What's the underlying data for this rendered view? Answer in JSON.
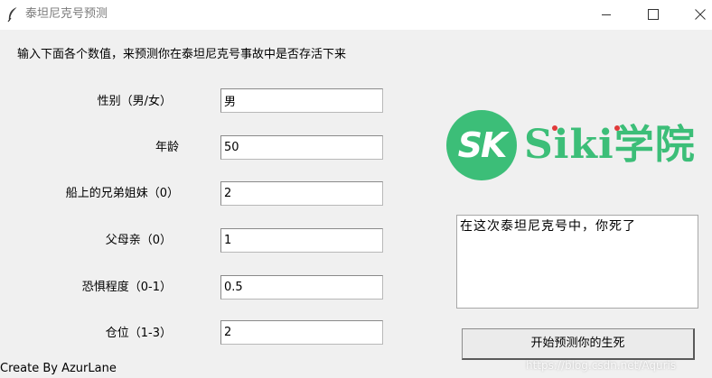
{
  "window": {
    "title": "泰坦尼克号预测",
    "controls": {
      "minimize": "minimize-icon",
      "maximize": "maximize-icon",
      "close": "close-icon"
    },
    "app_icon": "feather-icon"
  },
  "header": "输入下面各个数值，来预测你在泰坦尼克号事故中是否存活下来",
  "fields": [
    {
      "label": "性别（男/女）",
      "value": "男"
    },
    {
      "label": "年龄",
      "value": "50"
    },
    {
      "label": "船上的兄弟姐妹（0）",
      "value": "2"
    },
    {
      "label": "父母亲（0）",
      "value": "1"
    },
    {
      "label": "恐惧程度（0-1）",
      "value": "0.5"
    },
    {
      "label": "仓位（1-3）",
      "value": "2"
    }
  ],
  "logo": {
    "mark": "SK",
    "text": "Siki学院",
    "color": "#3cbe78"
  },
  "result_text": "在这次泰坦尼克号中，你死了",
  "predict_button": "开始预测你的生死",
  "credit": "Create By AzurLane",
  "watermark": "https://blog.csdn.net/Aquris"
}
